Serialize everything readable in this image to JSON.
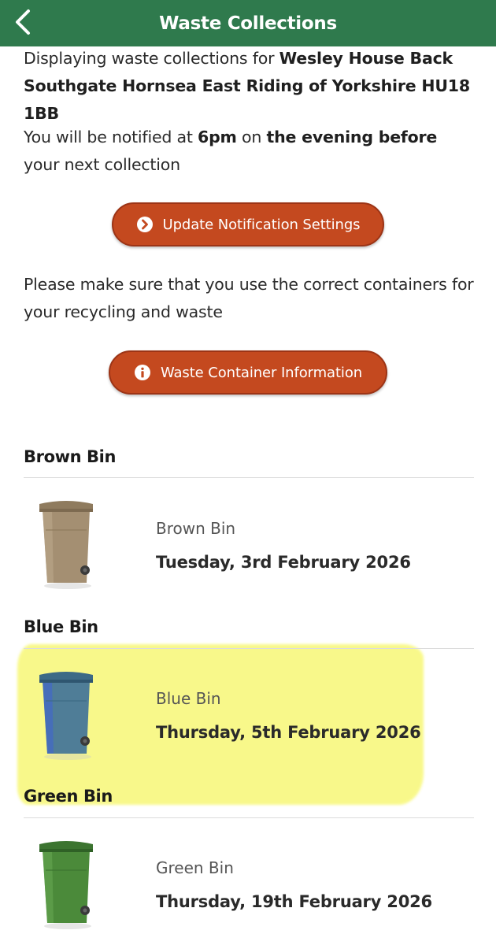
{
  "header": {
    "title": "Waste Collections",
    "back_icon": "chevron-left-icon",
    "color": "#2f7a4d"
  },
  "address_text": {
    "prefix": "Displaying waste collections for ",
    "address": "Wesley House  Back Southgate Hornsea East Riding of Yorkshire HU18 1BB"
  },
  "notification_text": {
    "part1": "You will be notified at ",
    "time": "6pm",
    "part2": " on ",
    "when": "the evening before",
    "part3": " your next collection"
  },
  "update_button": {
    "label": "Update Notification Settings",
    "icon": "chevron-right-circle-icon",
    "color": "#c4491f"
  },
  "containers_text": "Please make sure that you use the correct containers for your recycling and waste",
  "info_button": {
    "label": "Waste Container Information",
    "icon": "info-circle-icon",
    "color": "#c4491f"
  },
  "bins": [
    {
      "section_title": "Brown Bin",
      "name": "Brown Bin",
      "date": "Tuesday, 3rd February 2026",
      "color": "#a48f72"
    },
    {
      "section_title": "Blue Bin",
      "name": "Blue Bin",
      "date": "Thursday, 5th February 2026",
      "color": "#4f7d97",
      "highlighted": true
    },
    {
      "section_title": "Green Bin",
      "name": "Green Bin",
      "date": "Thursday, 19th February 2026",
      "color": "#4b8a3a"
    }
  ],
  "highlight_color": "#f7f76a"
}
